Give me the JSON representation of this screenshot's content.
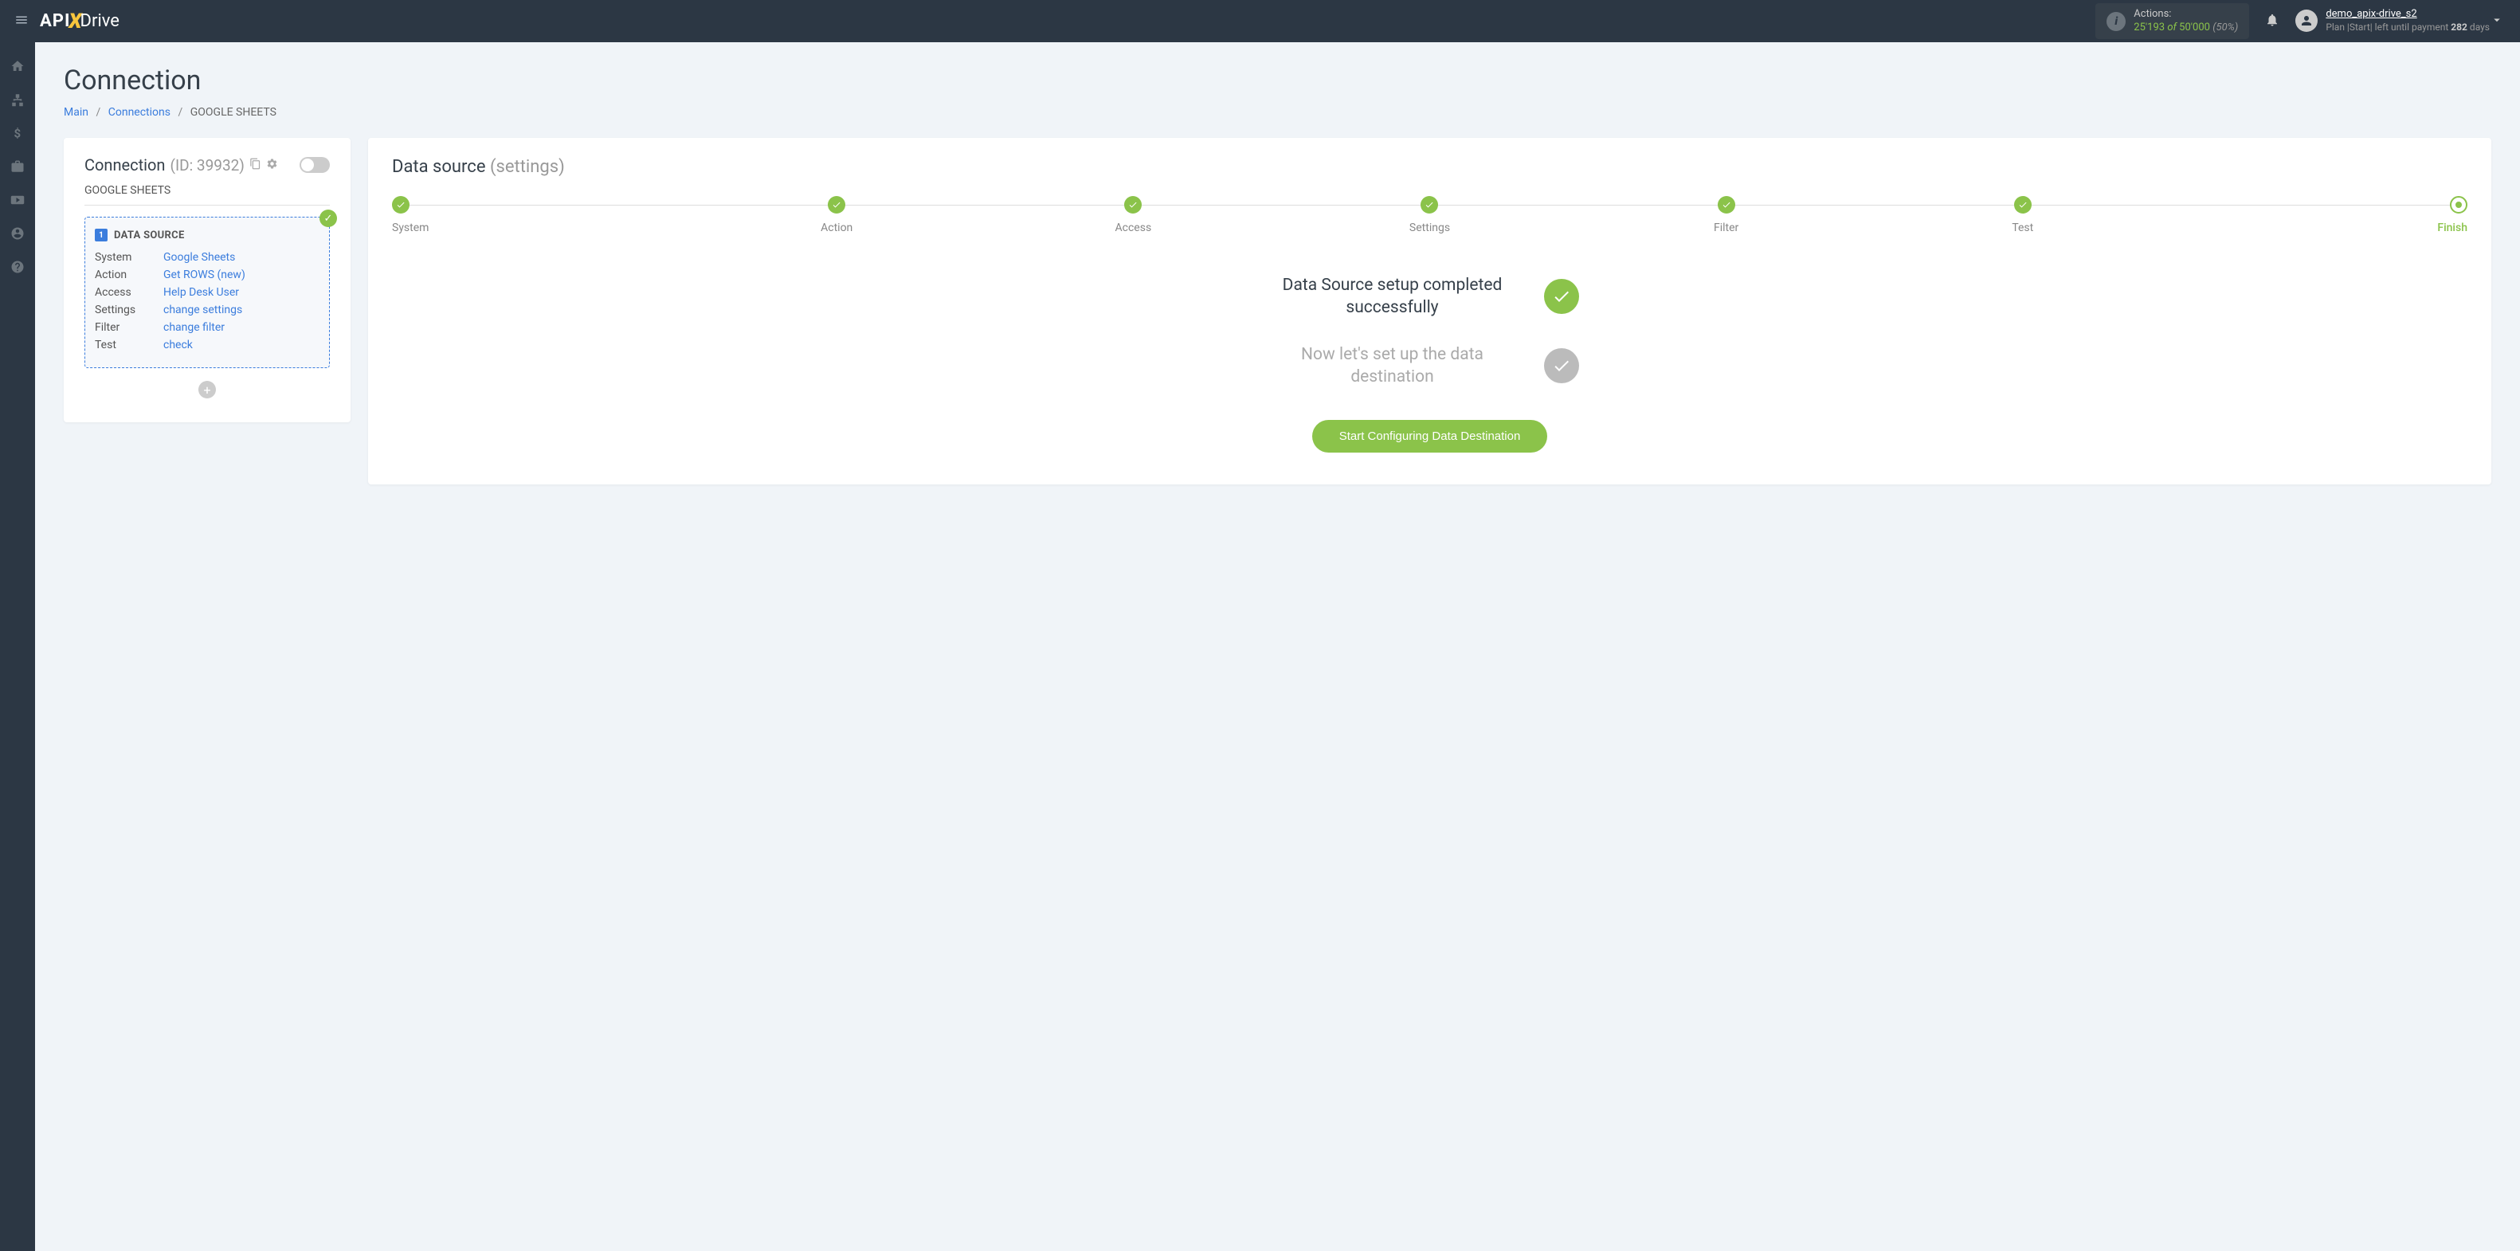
{
  "header": {
    "actions_label": "Actions:",
    "actions_used": "25'193",
    "actions_of": "of",
    "actions_total": "50'000",
    "actions_pct": "(50%)",
    "user_name": "demo_apix-drive_s2",
    "plan_prefix": "Plan |",
    "plan_name": "Start",
    "plan_mid": "| left until payment",
    "plan_days": "282",
    "plan_suffix": "days"
  },
  "page": {
    "title": "Connection"
  },
  "breadcrumb": {
    "main": "Main",
    "connections": "Connections",
    "current": "GOOGLE SHEETS"
  },
  "left": {
    "title": "Connection",
    "id": "(ID: 39932)",
    "subtitle": "GOOGLE SHEETS",
    "ds_title": "DATA SOURCE",
    "rows": [
      {
        "label": "System",
        "value": "Google Sheets"
      },
      {
        "label": "Action",
        "value": "Get ROWS (new)"
      },
      {
        "label": "Access",
        "value": "Help Desk User"
      },
      {
        "label": "Settings",
        "value": "change settings"
      },
      {
        "label": "Filter",
        "value": "change filter"
      },
      {
        "label": "Test",
        "value": "check"
      }
    ]
  },
  "right": {
    "title": "Data source",
    "subtitle": "(settings)",
    "steps": [
      {
        "label": "System",
        "state": "done"
      },
      {
        "label": "Action",
        "state": "done"
      },
      {
        "label": "Access",
        "state": "done"
      },
      {
        "label": "Settings",
        "state": "done"
      },
      {
        "label": "Filter",
        "state": "done"
      },
      {
        "label": "Test",
        "state": "done"
      },
      {
        "label": "Finish",
        "state": "current"
      }
    ],
    "msg1": "Data Source setup completed successfully",
    "msg2": "Now let's set up the data destination",
    "cta": "Start Configuring Data Destination"
  }
}
